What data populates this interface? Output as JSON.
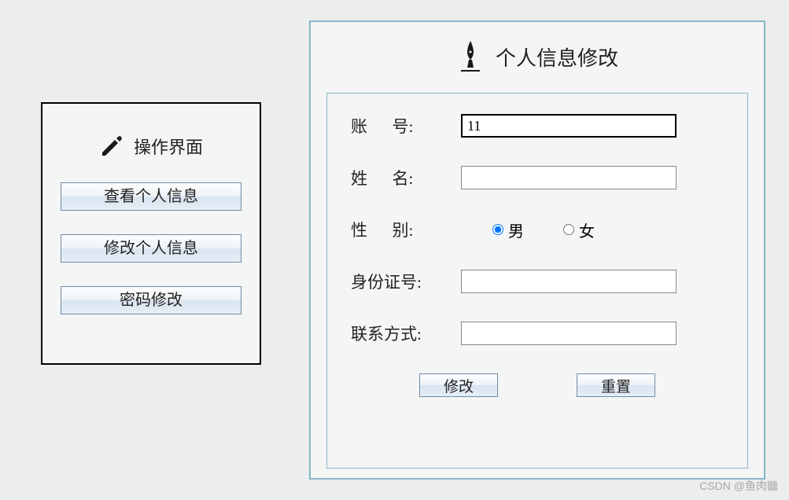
{
  "sidebar": {
    "title": "操作界面",
    "buttons": {
      "view_info": "查看个人信息",
      "edit_info": "修改个人信息",
      "change_password": "密码修改"
    }
  },
  "main": {
    "title": "个人信息修改",
    "form": {
      "account": {
        "label_char1": "账",
        "label_char2": "号",
        "value": "11"
      },
      "name": {
        "label_char1": "姓",
        "label_char2": "名",
        "value": ""
      },
      "gender": {
        "label_char1": "性",
        "label_char2": "别",
        "male": "男",
        "female": "女",
        "selected": "male"
      },
      "id_number": {
        "label": "身份证号",
        "value": ""
      },
      "contact": {
        "label": "联系方式",
        "value": ""
      }
    },
    "buttons": {
      "modify": "修改",
      "reset": "重置"
    }
  },
  "watermark": "CSDN @鱼肉𪚥"
}
